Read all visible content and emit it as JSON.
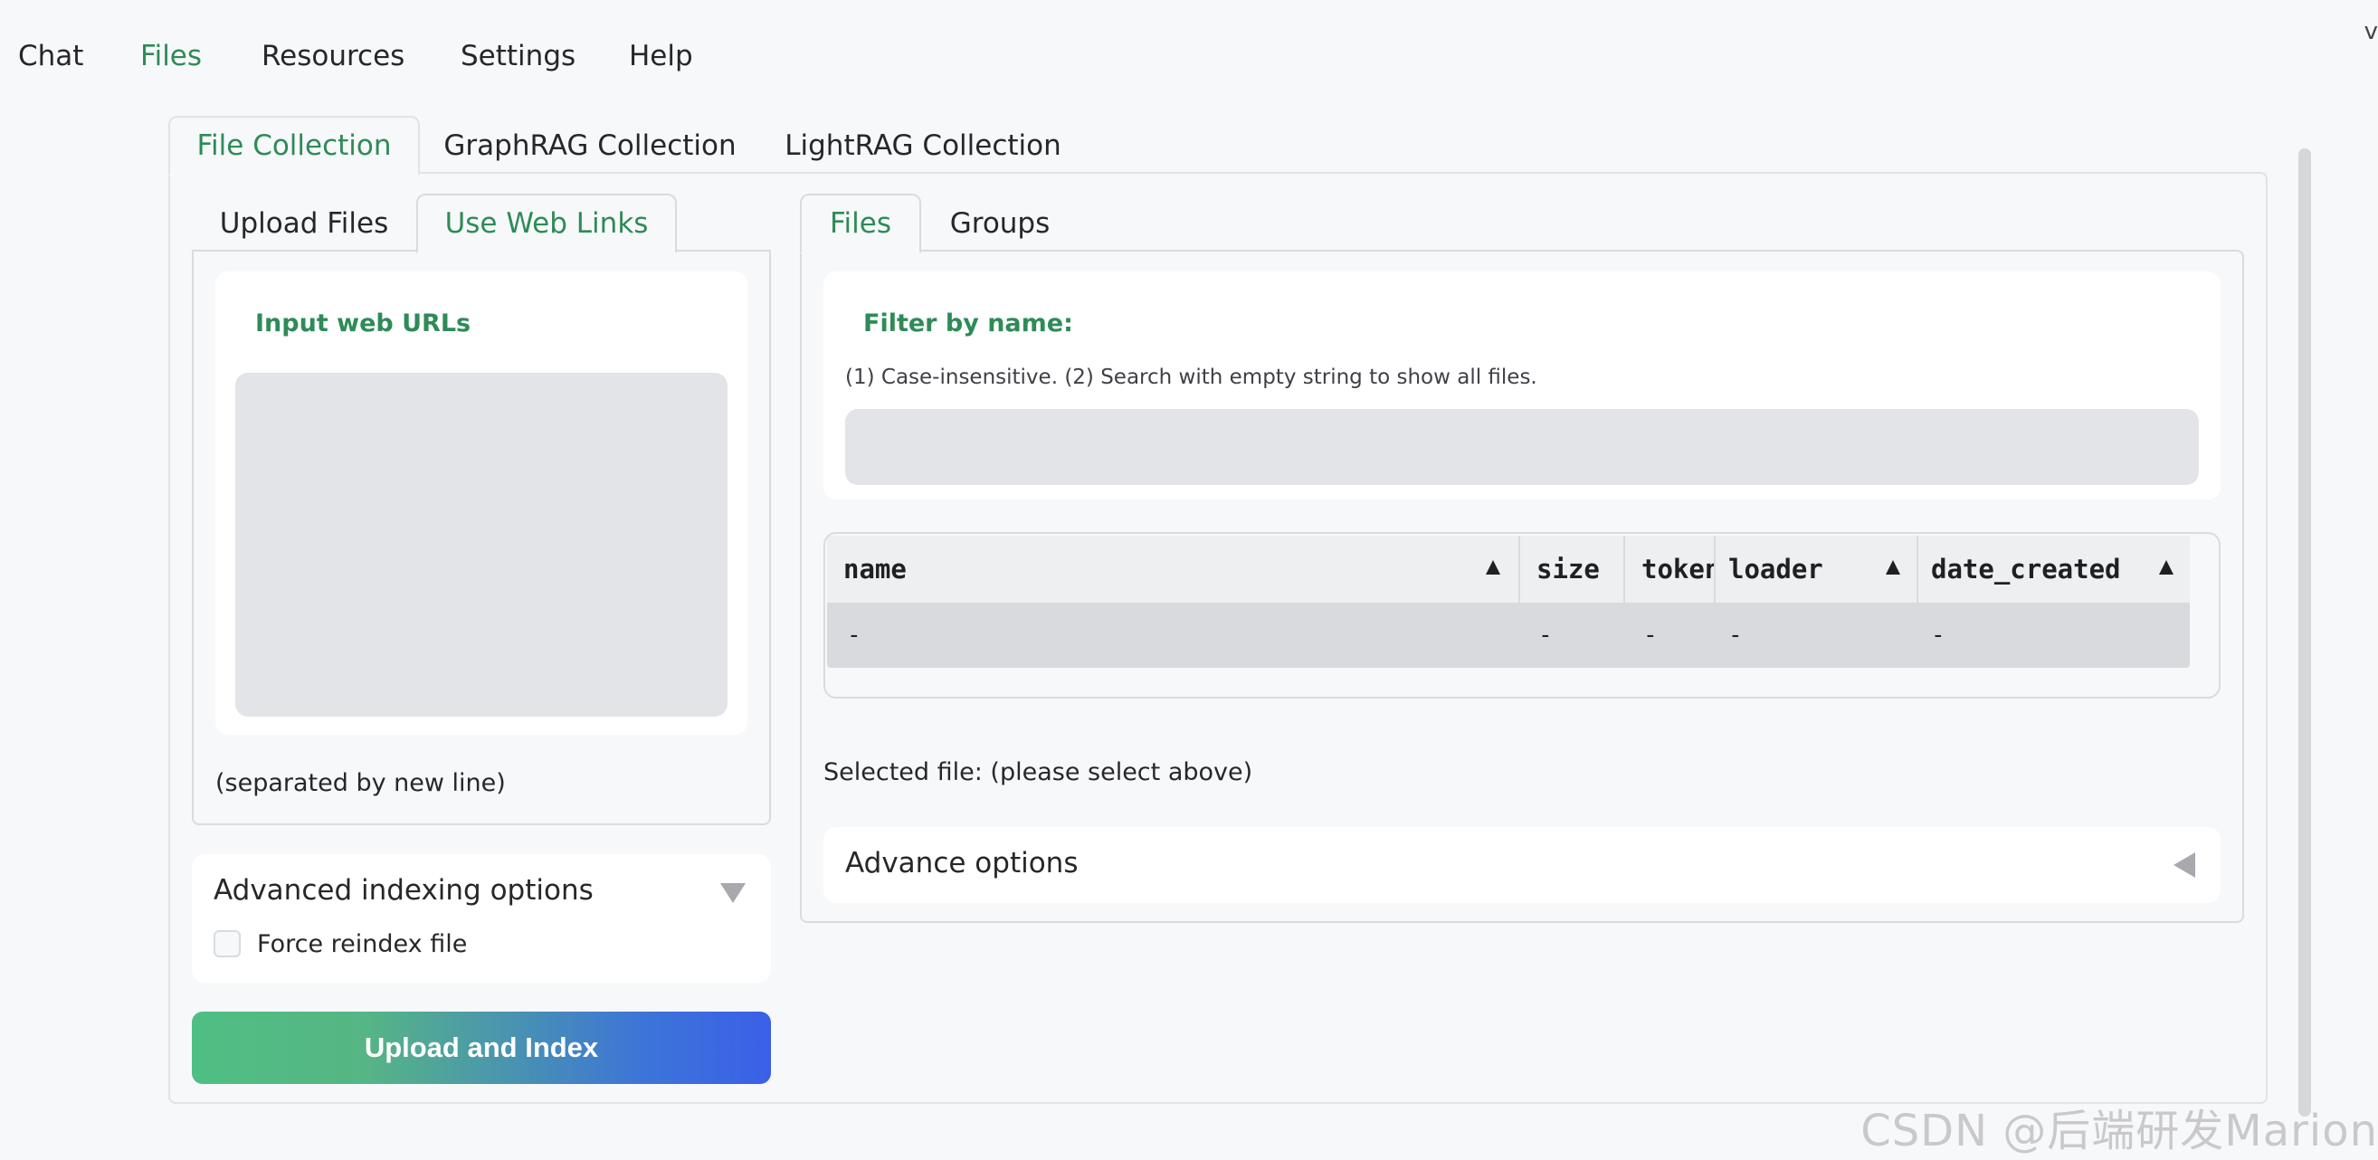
{
  "top_nav": {
    "items": [
      {
        "label": "Chat",
        "active": false
      },
      {
        "label": "Files",
        "active": true
      },
      {
        "label": "Resources",
        "active": false
      },
      {
        "label": "Settings",
        "active": false
      },
      {
        "label": "Help",
        "active": false
      }
    ],
    "corner_glyph": "v"
  },
  "collection_tabs": [
    {
      "label": "File Collection",
      "active": true
    },
    {
      "label": "GraphRAG Collection",
      "active": false
    },
    {
      "label": "LightRAG Collection",
      "active": false
    }
  ],
  "upload_tabs": [
    {
      "label": "Upload Files",
      "active": false
    },
    {
      "label": "Use Web Links",
      "active": true
    }
  ],
  "web_links": {
    "label": "Input web URLs",
    "value": "",
    "hint": "(separated by new line)"
  },
  "indexing_options": {
    "title": "Advanced indexing options",
    "force_reindex_label": "Force reindex file",
    "force_reindex_checked": false
  },
  "upload_button_label": "Upload and Index",
  "file_tabs": [
    {
      "label": "Files",
      "active": true
    },
    {
      "label": "Groups",
      "active": false
    }
  ],
  "filter": {
    "label": "Filter by name:",
    "info": "(1) Case-insensitive. (2) Search with empty string to show all files.",
    "value": ""
  },
  "file_table": {
    "columns": [
      "name",
      "size",
      "token",
      "loader",
      "date_created"
    ],
    "rows": [
      [
        "-",
        "-",
        "-",
        "-",
        "-"
      ]
    ]
  },
  "selected_file_text": "Selected file: (please select above)",
  "advance_options_title": "Advance options",
  "watermark": "CSDN @后端研发Marion",
  "colors": {
    "accent_green": "#2e8b57",
    "button_gradient_start": "#4fbf82",
    "button_gradient_end": "#3a60e8"
  }
}
